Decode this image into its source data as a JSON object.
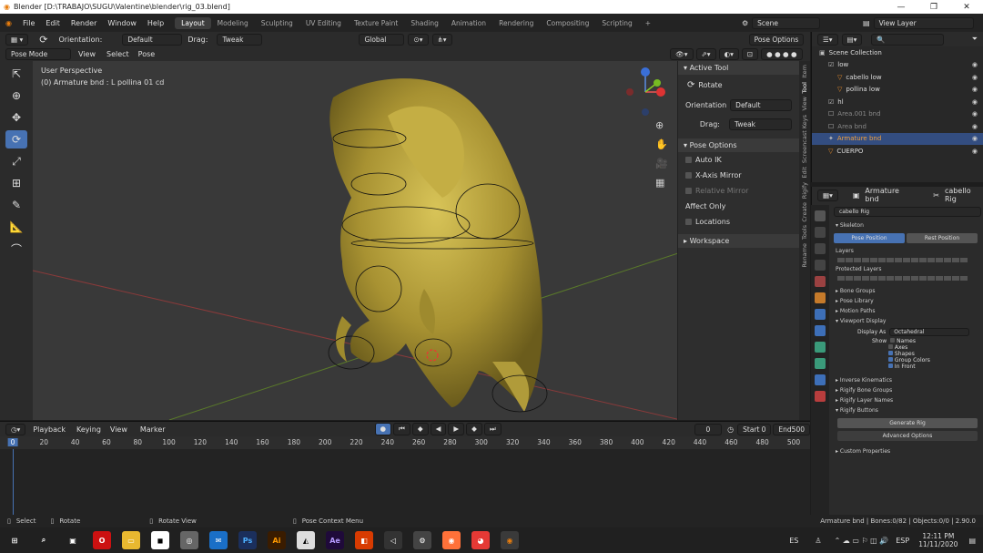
{
  "window": {
    "title": "Blender [D:\\TRABAJO\\SUGU\\Valentine\\blender\\rig_03.blend]",
    "min": "—",
    "max": "❐",
    "close": "✕"
  },
  "menu": [
    "File",
    "Edit",
    "Render",
    "Window",
    "Help"
  ],
  "workspaces": [
    "Layout",
    "Modeling",
    "Sculpting",
    "UV Editing",
    "Texture Paint",
    "Shading",
    "Animation",
    "Rendering",
    "Compositing",
    "Scripting",
    "+"
  ],
  "scene": {
    "label": "Scene",
    "view_layer": "View Layer"
  },
  "header": {
    "orientation_label": "Orientation:",
    "orientation_value": "Default",
    "drag_label": "Drag:",
    "drag_value": "Tweak",
    "global": "Global",
    "pose_options": "Pose Options"
  },
  "header2": {
    "mode": "Pose Mode",
    "view": "View",
    "select": "Select",
    "pose": "Pose"
  },
  "viewport": {
    "perspective": "User Perspective",
    "object": "(0) Armature bnd : L pollina 01 cd",
    "gizmo_x": "X",
    "gizmo_y": "Y",
    "gizmo_z": "Z"
  },
  "npanel": {
    "active_tool": "Active Tool",
    "tool": "Rotate",
    "orientation_label": "Orientation",
    "orientation_value": "Default",
    "drag_label": "Drag:",
    "drag_value": "Tweak",
    "pose_options": "Pose Options",
    "auto_ik": "Auto IK",
    "x_axis_mirror": "X-Axis Mirror",
    "relative_mirror": "Relative Mirror",
    "affect_only": "Affect Only",
    "locations": "Locations",
    "workspace": "Workspace"
  },
  "vtabs": [
    "Item",
    "Tool",
    "View",
    "Screencast Keys",
    "Edit",
    "Rigify",
    "Create",
    "Tools",
    "Rename"
  ],
  "outliner": {
    "search": "",
    "rows": [
      {
        "label": "Scene Collection",
        "indent": 0
      },
      {
        "label": "low",
        "indent": 1
      },
      {
        "label": "cabello low",
        "indent": 2
      },
      {
        "label": "pollina low",
        "indent": 2
      },
      {
        "label": "hl",
        "indent": 1
      },
      {
        "label": "Area.001 bnd",
        "indent": 1
      },
      {
        "label": "Area bnd",
        "indent": 1
      },
      {
        "label": "Armature bnd",
        "indent": 1
      },
      {
        "label": "CUERPO",
        "indent": 1
      }
    ]
  },
  "properties": {
    "object": "Armature bnd",
    "rig": "cabello Rig",
    "data_name": "cabello Rig",
    "skeleton": "Skeleton",
    "pose_position": "Pose Position",
    "rest_position": "Rest Position",
    "layers": "Layers",
    "protected_layers": "Protected Layers",
    "sections": [
      "Bone Groups",
      "Pose Library",
      "Motion Paths",
      "Viewport Display"
    ],
    "display_as_label": "Display As",
    "display_as_value": "Octahedral",
    "show_label": "Show",
    "show_items": [
      "Names",
      "Axes",
      "Shapes",
      "Group Colors",
      "In Front"
    ],
    "sections2": [
      "Inverse Kinematics",
      "Rigify Bone Groups",
      "Rigify Layer Names",
      "Rigify Buttons"
    ],
    "generate": "Generate Rig",
    "advanced": "Advanced Options",
    "custom": "Custom Properties"
  },
  "timeline": {
    "playback": "Playback",
    "keying": "Keying",
    "view": "View",
    "marker": "Marker",
    "current": "0",
    "start_label": "Start",
    "start": "0",
    "end_label": "End",
    "end": "500",
    "ticks": [
      "0",
      "20",
      "40",
      "60",
      "80",
      "100",
      "120",
      "140",
      "160",
      "180",
      "200",
      "220",
      "240",
      "260",
      "280",
      "300",
      "320",
      "340",
      "360",
      "380",
      "400",
      "420",
      "440",
      "460",
      "480",
      "500"
    ]
  },
  "status": {
    "select": "Select",
    "rotate": "Rotate",
    "rotate_view": "Rotate View",
    "context": "Pose Context Menu",
    "info": "Armature bnd | Bones:0/82 | Objects:0/0 | 2.90.0"
  },
  "taskbar": {
    "lang": "ES",
    "kb": "ESP",
    "time": "12:11 PM",
    "date": "11/11/2020"
  },
  "colors": {
    "accent": "#4772b3",
    "model": "#b9a43a"
  }
}
